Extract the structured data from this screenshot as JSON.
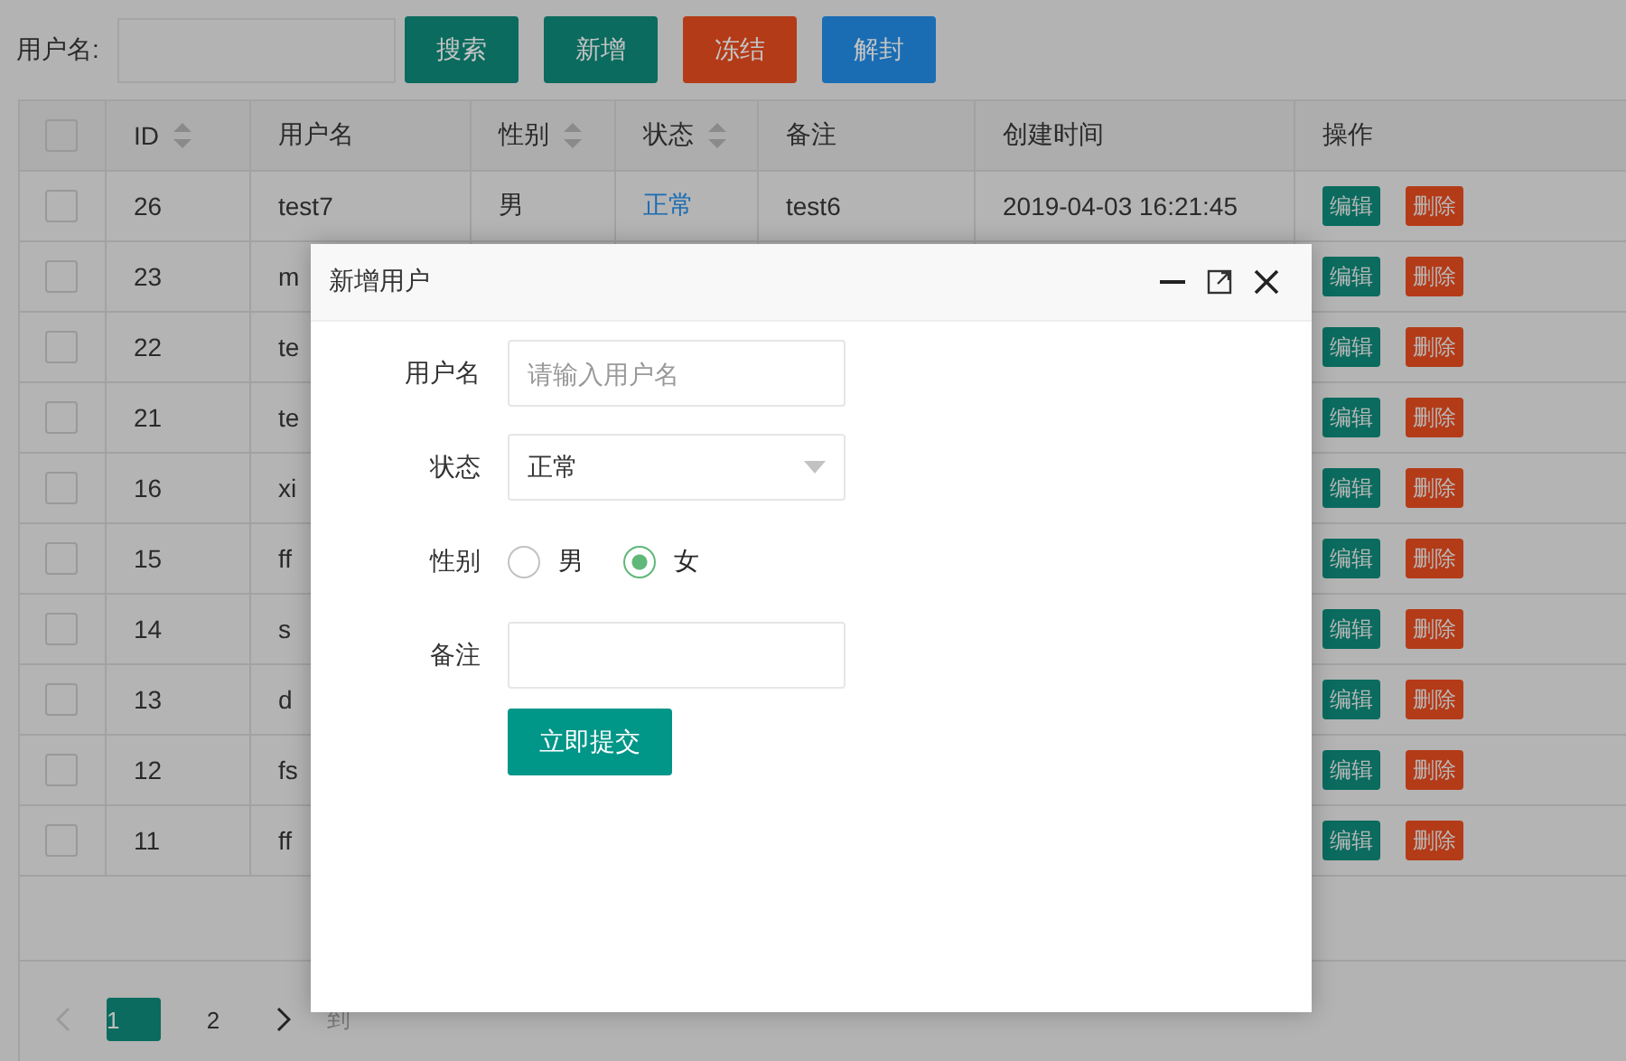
{
  "search": {
    "label": "用户名:",
    "buttons": [
      {
        "label": "搜索",
        "kind": "primary"
      },
      {
        "label": "新增",
        "kind": "primary"
      },
      {
        "label": "冻结",
        "kind": "danger"
      },
      {
        "label": "解封",
        "kind": "info"
      }
    ]
  },
  "table": {
    "all_checked": false,
    "columns": [
      {
        "label": "ID",
        "sortable": true
      },
      {
        "label": "用户名",
        "sortable": false
      },
      {
        "label": "性别",
        "sortable": true
      },
      {
        "label": "状态",
        "sortable": true
      },
      {
        "label": "备注",
        "sortable": false
      },
      {
        "label": "创建时间",
        "sortable": false
      },
      {
        "label": "操作",
        "sortable": false
      }
    ],
    "rows": [
      {
        "checked": false,
        "cells": [
          "26",
          "test7",
          "男",
          "正常",
          "test6",
          "2019-04-03 16:21:45"
        ],
        "actions": [
          "编辑",
          "删除"
        ]
      },
      {
        "checked": false,
        "cells": [
          "23",
          "m"
        ],
        "actions": [
          "编辑",
          "删除"
        ]
      },
      {
        "checked": false,
        "cells": [
          "22",
          "te"
        ],
        "actions": [
          "编辑",
          "删除"
        ]
      },
      {
        "checked": false,
        "cells": [
          "21",
          "te"
        ],
        "actions": [
          "编辑",
          "删除"
        ]
      },
      {
        "checked": false,
        "cells": [
          "16",
          "xi"
        ],
        "actions": [
          "编辑",
          "删除"
        ]
      },
      {
        "checked": false,
        "cells": [
          "15",
          "ff"
        ],
        "actions": [
          "编辑",
          "删除"
        ]
      },
      {
        "checked": false,
        "cells": [
          "14",
          "s"
        ],
        "actions": [
          "编辑",
          "删除"
        ]
      },
      {
        "checked": false,
        "cells": [
          "13",
          "d"
        ],
        "actions": [
          "编辑",
          "删除"
        ]
      },
      {
        "checked": false,
        "cells": [
          "12",
          "fs"
        ],
        "actions": [
          "编辑",
          "删除"
        ]
      },
      {
        "checked": false,
        "cells": [
          "11",
          "ff"
        ],
        "actions": [
          "编辑",
          "删除"
        ]
      }
    ]
  },
  "pagination": {
    "pages": [
      {
        "label": "1",
        "selected": true
      },
      {
        "label": "2",
        "selected": false
      }
    ],
    "goto": "到"
  },
  "dialog": {
    "title": "新增用户",
    "fields": [
      {
        "kind": "text",
        "label": "用户名",
        "placeholder": "请输入用户名"
      },
      {
        "kind": "select",
        "label": "状态",
        "value": "正常"
      },
      {
        "kind": "radio",
        "label": "性别",
        "options": [
          {
            "label": "男",
            "selected": false
          },
          {
            "label": "女",
            "selected": true
          }
        ]
      },
      {
        "kind": "text",
        "label": "备注"
      }
    ],
    "submit": "立即提交"
  }
}
